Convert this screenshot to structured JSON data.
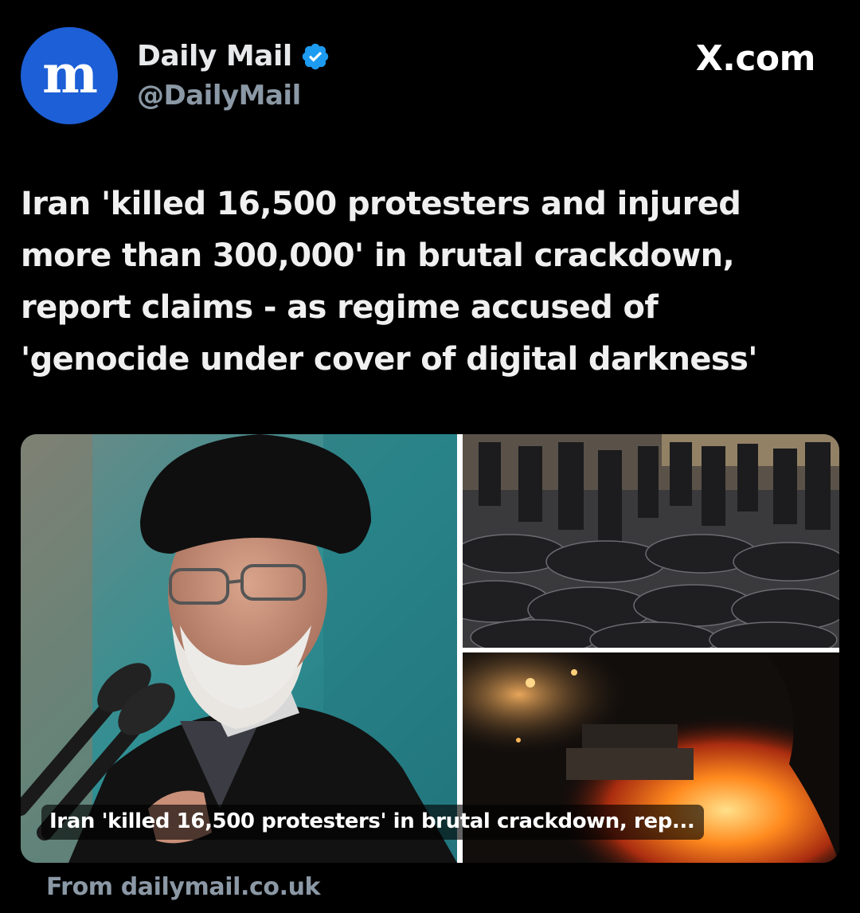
{
  "author": {
    "display_name": "Daily Mail",
    "handle": "@DailyMail",
    "avatar_glyph": "m",
    "avatar_color": "#1d5fd6",
    "verified_icon": "verified-badge-icon",
    "verified_color": "#1d9bf0"
  },
  "brand": {
    "label": "X.com"
  },
  "post": {
    "headline": "Iran 'killed 16,500 protesters and injured more than 300,000' in brutal crackdown, report claims - as regime accused of 'genocide under cover of digital darkness'"
  },
  "link_card": {
    "caption": "Iran 'killed 16,500 protesters' in brutal crackdown, rep...",
    "images": [
      "cleric-portrait-photo",
      "body-bags-photo",
      "street-fire-night-photo"
    ],
    "source_prefix": "From",
    "source_domain": "dailymail.co.uk"
  },
  "colors": {
    "background": "#000000",
    "text_primary": "#e7e9ea",
    "text_secondary": "#8b98a5"
  }
}
